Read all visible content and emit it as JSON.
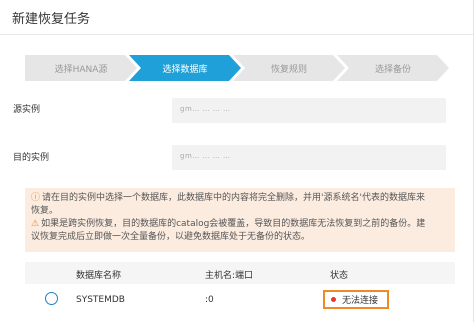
{
  "dialog": {
    "title": "新建恢复任务"
  },
  "steps": [
    {
      "label": "选择HANA源",
      "active": false
    },
    {
      "label": "选择数据库",
      "active": true
    },
    {
      "label": "恢复规则",
      "active": false
    },
    {
      "label": "选择备份",
      "active": false
    }
  ],
  "form": {
    "source_label": "源实例",
    "source_value": "gm… … … …",
    "target_label": "目的实例",
    "target_value": "gm… … … …"
  },
  "notice": {
    "line1": "请在目的实例中选择一个数据库，此数据库中的内容将完全删除，并用'源系统名'代表的数据库来",
    "line1b": "恢复。",
    "line2": "如果是跨实例恢复，目的数据库的catalog会被覆盖，导致目的数据库无法恢复到之前的备份。建",
    "line3": "议恢复完成后立即做一次全量备份，以避免数据库处于无备份的状态。"
  },
  "table": {
    "headers": [
      "数据库名称",
      "主机名:端口",
      "状态"
    ],
    "rows": [
      {
        "name": "SYSTEMDB",
        "host_port": ":0",
        "status": "无法连接"
      }
    ]
  },
  "colors": {
    "active_step": "#1fa0d8",
    "notice_bg": "#fcece0",
    "highlight": "#f08a24",
    "status_dot": "#e33333"
  }
}
